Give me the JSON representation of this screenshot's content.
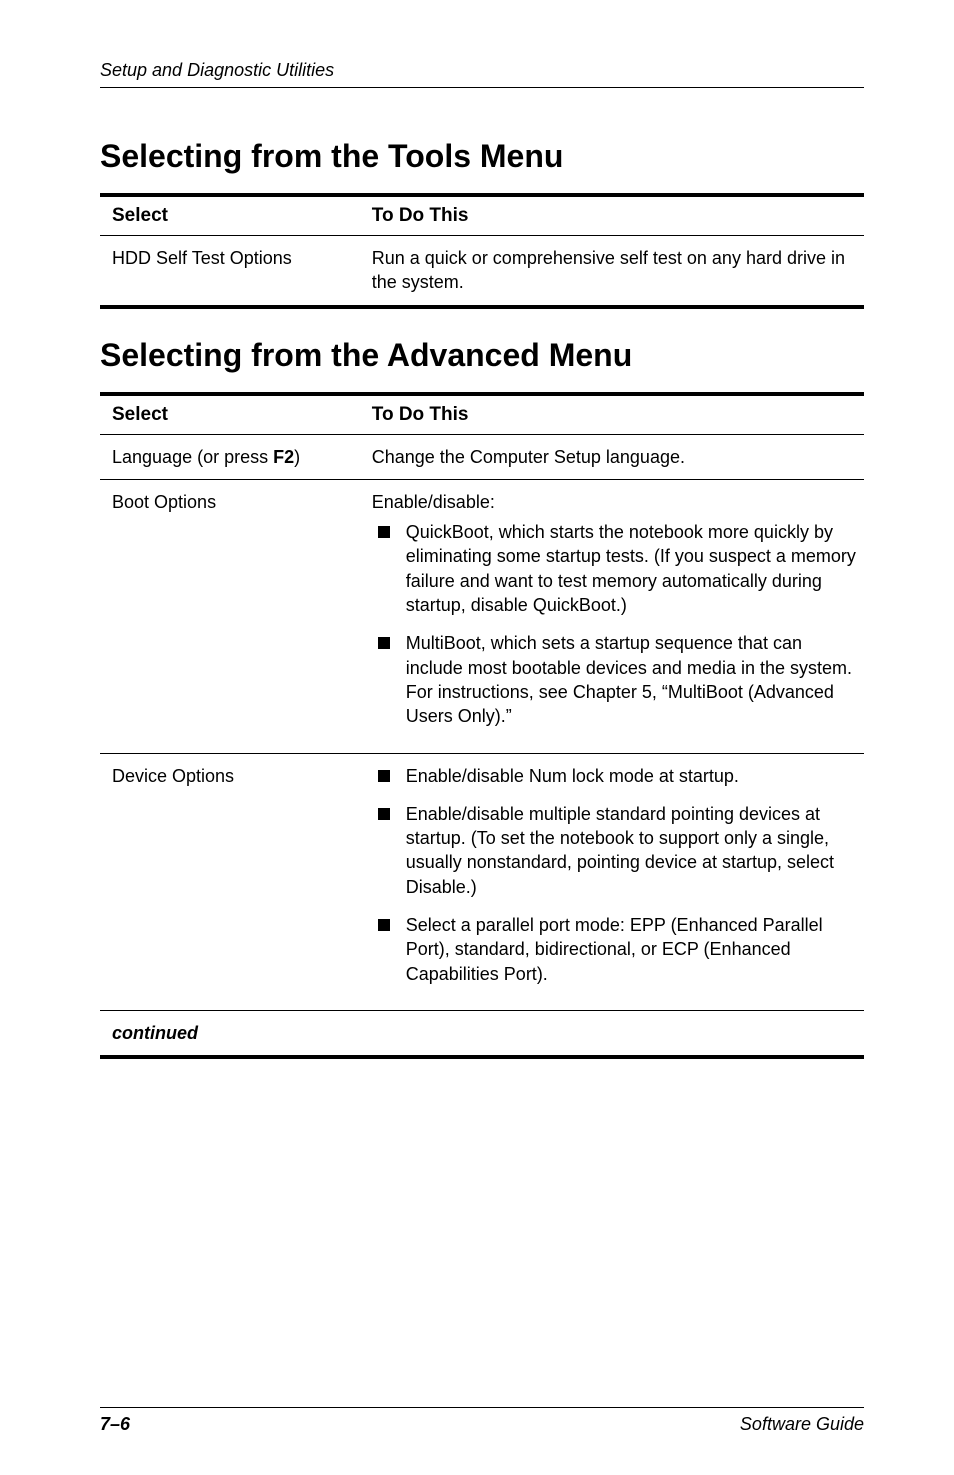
{
  "running_head": "Setup and Diagnostic Utilities",
  "section_tools": {
    "title": "Selecting from the Tools Menu",
    "header_select": "Select",
    "header_todo": "To Do This",
    "row1_select": "HDD Self Test Options",
    "row1_todo": "Run a quick or comprehensive self test on any hard drive in the system."
  },
  "section_adv": {
    "title": "Selecting from the Advanced Menu",
    "header_select": "Select",
    "header_todo": "To Do This",
    "row_lang_select_pre": "Language (or press ",
    "row_lang_select_key": "F2",
    "row_lang_select_post": ")",
    "row_lang_todo": "Change the Computer Setup language.",
    "row_boot_select": "Boot Options",
    "row_boot_lead": "Enable/disable:",
    "row_boot_b1": "QuickBoot, which starts the notebook more quickly by eliminating some startup tests. (If you suspect a memory failure and want to test memory automatically during startup, disable QuickBoot.)",
    "row_boot_b2": "MultiBoot, which sets a startup sequence that can include most bootable devices and media in the system. For instructions, see Chapter 5, “MultiBoot (Advanced Users Only).”",
    "row_dev_select": "Device Options",
    "row_dev_b1": "Enable/disable Num lock mode at startup.",
    "row_dev_b2": "Enable/disable multiple standard pointing devices at startup. (To set the notebook to support only a single, usually nonstandard, pointing device at startup, select Disable.)",
    "row_dev_b3": "Select a parallel port mode: EPP (Enhanced Parallel Port), standard, bidirectional, or ECP (Enhanced Capabilities Port).",
    "continued": "continued"
  },
  "footer": {
    "left": "7–6",
    "right": "Software Guide"
  },
  "chart_data": {
    "type": "table",
    "tables": [
      {
        "title": "Selecting from the Tools Menu",
        "columns": [
          "Select",
          "To Do This"
        ],
        "rows": [
          [
            "HDD Self Test Options",
            "Run a quick or comprehensive self test on any hard drive in the system."
          ]
        ]
      },
      {
        "title": "Selecting from the Advanced Menu",
        "columns": [
          "Select",
          "To Do This"
        ],
        "rows": [
          [
            "Language (or press F2)",
            "Change the Computer Setup language."
          ],
          [
            "Boot Options",
            "Enable/disable: QuickBoot, which starts the notebook more quickly by eliminating some startup tests. (If you suspect a memory failure and want to test memory automatically during startup, disable QuickBoot.) MultiBoot, which sets a startup sequence that can include most bootable devices and media in the system. For instructions, see Chapter 5, “MultiBoot (Advanced Users Only).”"
          ],
          [
            "Device Options",
            "Enable/disable Num lock mode at startup. Enable/disable multiple standard pointing devices at startup. (To set the notebook to support only a single, usually nonstandard, pointing device at startup, select Disable.) Select a parallel port mode: EPP (Enhanced Parallel Port), standard, bidirectional, or ECP (Enhanced Capabilities Port)."
          ]
        ]
      }
    ]
  }
}
